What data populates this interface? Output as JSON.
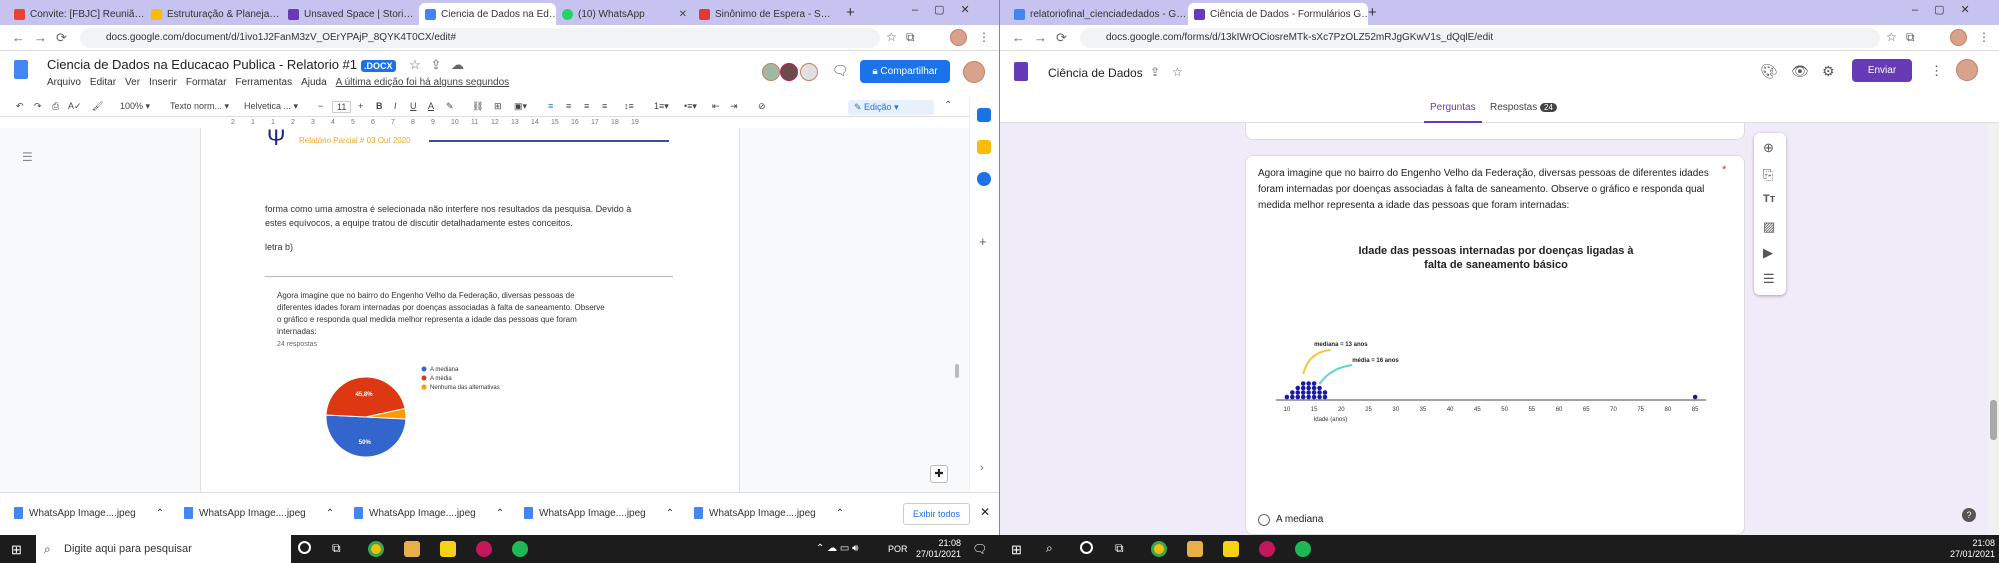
{
  "left_browser": {
    "tabs": [
      {
        "title": "Convite: [FBJC] Reuniã…",
        "color": "#ea4335"
      },
      {
        "title": "Estruturação & Planeja…",
        "color": "#fbbc04"
      },
      {
        "title": "Unsaved Space | Stori…",
        "color": "#673ab7"
      },
      {
        "title": "Ciencia de Dados na Ed…",
        "color": "#4285f4"
      },
      {
        "title": "(10) WhatsApp",
        "color": "#25d366"
      },
      {
        "title": "Sinônimo de Espera - S…",
        "color": "#e53935"
      }
    ],
    "url": "docs.google.com/document/d/1ivo1J2FanM3zV_OErYPAjP_8QYK4T0CX/edit#",
    "doc_title": "Ciencia de Dados na Educacao Publica - Relatorio #1",
    "doc_badge": ".DOCX",
    "share_label": "Compartilhar",
    "menus": [
      "Arquivo",
      "Editar",
      "Ver",
      "Inserir",
      "Formatar",
      "Ferramentas",
      "Ajuda"
    ],
    "last_edit": "A última edição foi há alguns segundos",
    "toolbar": {
      "zoom": "100%",
      "style": "Texto norm...",
      "font": "Helvetica ...",
      "size": "11",
      "mode": "Edição"
    },
    "ruler_ticks": [
      "2",
      "1",
      "1",
      "2",
      "3",
      "4",
      "5",
      "6",
      "7",
      "8",
      "9",
      "10",
      "11",
      "12",
      "13",
      "14",
      "15",
      "16",
      "17",
      "18",
      "19"
    ],
    "doc": {
      "header_subtitle": "Relatório Parcial # 03 Out 2020",
      "para1_line1": "forma como uma amostra é selecionada não interfere nos resultados da pesquisa. Devido à",
      "para1_line2": "estes equívocos, a equipe tratou de discutir detalhadamente estes conceitos.",
      "para2": "letra b)",
      "embedded_question_l1": "Agora imagine que no bairro do Engenho Velho da Federação, diversas pessoas de",
      "embedded_question_l2": "diferentes idades foram internadas por doenças associadas à falta de saneamento. Observe",
      "embedded_question_l3": "o gráfico e responda qual medida melhor representa a idade das pessoas que foram",
      "embedded_question_l4": "internadas:",
      "responses": "24 respostas"
    },
    "downloads": [
      "WhatsApp Image....jpeg",
      "WhatsApp Image....jpeg",
      "WhatsApp Image....jpeg",
      "WhatsApp Image....jpeg",
      "WhatsApp Image....jpeg"
    ],
    "show_all": "Exibir todos"
  },
  "chart_data": [
    {
      "type": "pie",
      "title": "",
      "labels": [
        "A mediana",
        "A média",
        "Nenhuma das alternativas"
      ],
      "values": [
        50.0,
        45.8,
        4.2
      ],
      "data_labels": [
        "50%",
        "45,8%",
        ""
      ],
      "colors": [
        "#3366cc",
        "#dc3912",
        "#ff9900"
      ],
      "legend": "right"
    },
    {
      "type": "scatter",
      "title": "Idade das pessoas internadas por doenças ligadas à falta de saneamento básico",
      "xlabel": "Idade (anos)",
      "ylabel": "",
      "xticks": [
        10,
        15,
        20,
        25,
        30,
        35,
        40,
        45,
        50,
        55,
        60,
        65,
        70,
        75,
        80,
        85
      ],
      "xlim": [
        8,
        87
      ],
      "grid": false,
      "points": [
        {
          "x": 10,
          "stack": 1
        },
        {
          "x": 11,
          "stack": 2
        },
        {
          "x": 12,
          "stack": 3
        },
        {
          "x": 13,
          "stack": 4
        },
        {
          "x": 14,
          "stack": 4
        },
        {
          "x": 15,
          "stack": 4
        },
        {
          "x": 16,
          "stack": 3
        },
        {
          "x": 17,
          "stack": 2
        },
        {
          "x": 85,
          "stack": 1
        }
      ],
      "annotations": [
        "mediana = 13 anos",
        "média = 16 anos"
      ]
    }
  ],
  "right_browser": {
    "tabs": [
      {
        "title": "relatoriofinal_cienciadedados - G…",
        "color": "#4285f4"
      },
      {
        "title": "Ciência de Dados - Formulários G…",
        "color": "#673ab7"
      }
    ],
    "url": "docs.google.com/forms/d/13kIWrOCiosreMTk-sXc7PzOLZ52mRJgGKwV1s_dQqlE/edit",
    "form_title": "Ciência de Dados",
    "send_label": "Enviar",
    "tab_questions": "Perguntas",
    "tab_responses": "Respostas",
    "responses_count": "24",
    "question_text": "Agora imagine que no bairro do Engenho Velho da Federação, diversas pessoas de diferentes idades foram internadas por doenças associadas à falta de saneamento. Observe o gráfico e responda qual medida melhor representa a idade das pessoas que foram internadas:",
    "required_mark": "*",
    "option1": "A mediana"
  },
  "taskbar": {
    "search_placeholder": "Digite aqui para pesquisar",
    "lang": "POR",
    "time_left": "21:08",
    "date_left": "27/01/2021",
    "time_right": "21:08",
    "date_right": "27/01/2021"
  }
}
